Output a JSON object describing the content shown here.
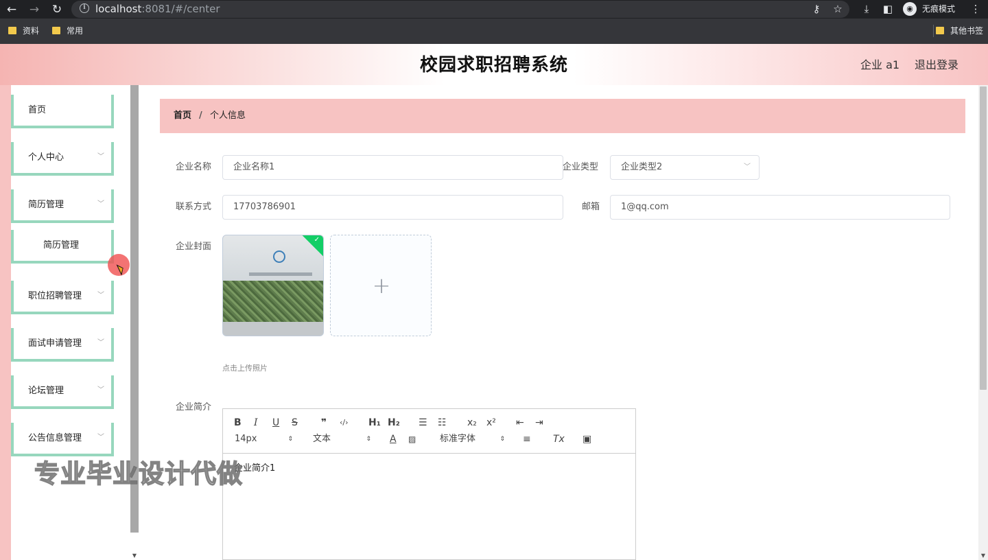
{
  "browser": {
    "url_host": "localhost",
    "url_rest": ":8081/#/center",
    "incognito_label": "无痕模式",
    "bookmarks": [
      {
        "label": "资料"
      },
      {
        "label": "常用"
      }
    ],
    "other_bookmarks": "其他书签"
  },
  "header": {
    "title": "校园求职招聘系统",
    "user": "企业 a1",
    "logout": "退出登录"
  },
  "sidebar": {
    "items": [
      {
        "label": "首页"
      },
      {
        "label": "个人中心"
      },
      {
        "label": "简历管理"
      },
      {
        "label": "简历管理"
      },
      {
        "label": "职位招聘管理"
      },
      {
        "label": "面试申请管理"
      },
      {
        "label": "论坛管理"
      },
      {
        "label": "公告信息管理"
      }
    ]
  },
  "breadcrumb": {
    "home": "首页",
    "separator": "/",
    "current": "个人信息"
  },
  "form": {
    "company_name_label": "企业名称",
    "company_name_value": "企业名称1",
    "company_type_label": "企业类型",
    "company_type_value": "企业类型2",
    "contact_label": "联系方式",
    "contact_value": "17703786901",
    "email_label": "邮箱",
    "email_value": "1@qq.com",
    "cover_label": "企业封面",
    "upload_tip": "点击上传照片",
    "intro_label": "企业简介",
    "intro_value": "企业简介1"
  },
  "editor": {
    "font_size": "14px",
    "block_type": "文本",
    "font_family": "标准字体"
  },
  "watermark": "专业毕业设计代做"
}
